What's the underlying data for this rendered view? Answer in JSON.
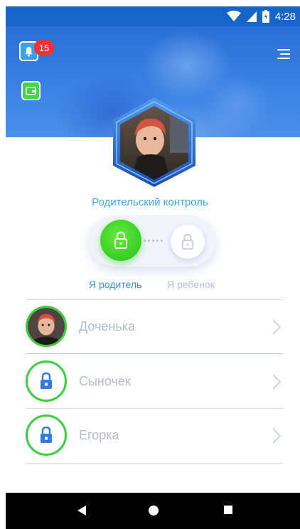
{
  "status_bar": {
    "time": "4:28"
  },
  "header": {
    "notification_count": "15",
    "icons": [
      "bell-icon",
      "wallet-icon",
      "menu-icon"
    ]
  },
  "parental_control": {
    "title": "Родительский контроль",
    "role_parent": "Я родитель",
    "role_child": "Я ребенок",
    "selected": "parent"
  },
  "children": [
    {
      "name": "Доченька",
      "avatar": "photo"
    },
    {
      "name": "Сыночек",
      "avatar": "lock-icon"
    },
    {
      "name": "Егорка",
      "avatar": "lock-icon"
    }
  ],
  "colors": {
    "accent_blue": "#3fa6e8",
    "active_green": "#36cf22",
    "badge_red": "#e8343a"
  }
}
